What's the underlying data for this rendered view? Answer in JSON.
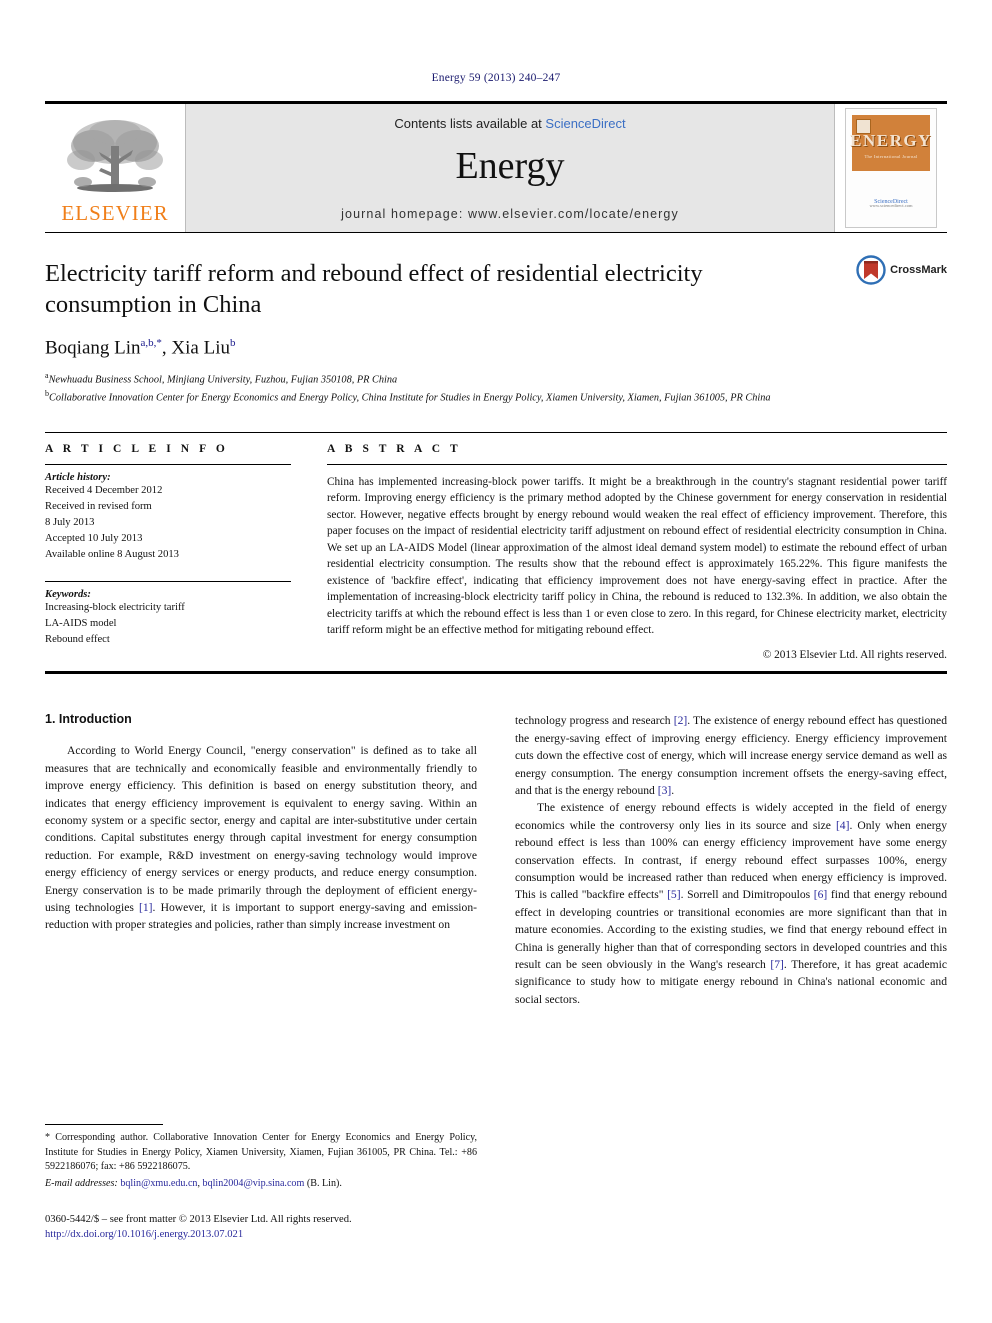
{
  "running_head": "Energy 59 (2013) 240–247",
  "masthead": {
    "publisher_name": "ELSEVIER",
    "contents_prefix": "Contents lists available at ",
    "sciencedirect": "ScienceDirect",
    "journal_name": "Energy",
    "homepage": "journal homepage: www.elsevier.com/locate/energy",
    "cover": {
      "title": "ENERGY",
      "subtitle": "The International Journal",
      "footer": "Available online at",
      "footer_link": "ScienceDirect",
      "footer_note": "www.sciencedirect.com"
    }
  },
  "article": {
    "title": "Electricity tariff reform and rebound effect of residential electricity consumption in China",
    "crossmark_label": "CrossMark",
    "authors": "Boqiang Lin",
    "authors_sup1": "a,b,*",
    "authors_sep": ", Xia Liu",
    "authors_sup2": "b",
    "affiliation_a_sup": "a",
    "affiliation_a": "Newhuadu Business School, Minjiang University, Fuzhou, Fujian 350108, PR China",
    "affiliation_b_sup": "b",
    "affiliation_b": "Collaborative Innovation Center for Energy Economics and Energy Policy, China Institute for Studies in Energy Policy, Xiamen University, Xiamen, Fujian 361005, PR China"
  },
  "info": {
    "heading": "A R T I C L E   I N F O",
    "history_label": "Article history:",
    "history": [
      "Received 4 December 2012",
      "Received in revised form",
      "8 July 2013",
      "Accepted 10 July 2013",
      "Available online 8 August 2013"
    ],
    "keywords_label": "Keywords:",
    "keywords": [
      "Increasing-block electricity tariff",
      "LA-AIDS model",
      "Rebound effect"
    ]
  },
  "abstract": {
    "heading": "A B S T R A C T",
    "text": "China has implemented increasing-block power tariffs. It might be a breakthrough in the country's stagnant residential power tariff reform. Improving energy efficiency is the primary method adopted by the Chinese government for energy conservation in residential sector. However, negative effects brought by energy rebound would weaken the real effect of efficiency improvement. Therefore, this paper focuses on the impact of residential electricity tariff adjustment on rebound effect of residential electricity consumption in China. We set up an LA-AIDS Model (linear approximation of the almost ideal demand system model) to estimate the rebound effect of urban residential electricity consumption. The results show that the rebound effect is approximately 165.22%. This figure manifests the existence of 'backfire effect', indicating that efficiency improvement does not have energy-saving effect in practice. After the implementation of increasing-block electricity tariff policy in China, the rebound is reduced to 132.3%. In addition, we also obtain the electricity tariffs at which the rebound effect is less than 1 or even close to zero. In this regard, for Chinese electricity market, electricity tariff reform might be an effective method for mitigating rebound effect.",
    "copyright": "© 2013 Elsevier Ltd. All rights reserved."
  },
  "body": {
    "section_title": "1. Introduction",
    "left_paragraph_1_a": "According to World Energy Council, \"energy conservation\" is defined as to take all measures that are technically and economically feasible and environmentally friendly to improve energy efficiency. This definition is based on energy substitution theory, and indicates that energy efficiency improvement is equivalent to energy saving. Within an economy system or a specific sector, energy and capital are inter-substitutive under certain conditions. Capital substitutes energy through capital investment for energy consumption reduction. For example, R&D investment on energy-saving technology would improve energy efficiency of energy services or energy products, and reduce energy consumption. Energy conservation is to be made primarily through the deployment of efficient energy-using technologies ",
    "left_ref_1": "[1]",
    "left_paragraph_1_b": ". However, it is important to support energy-saving and emission-reduction with proper strategies and policies, rather than simply increase investment on",
    "right_paragraph_1_a": "technology progress and research ",
    "right_ref_2": "[2]",
    "right_paragraph_1_b": ". The existence of energy rebound effect has questioned the energy-saving effect of improving energy efficiency. Energy efficiency improvement cuts down the effective cost of energy, which will increase energy service demand as well as energy consumption. The energy consumption increment offsets the energy-saving effect, and that is the energy rebound ",
    "right_ref_3": "[3]",
    "right_paragraph_1_c": ".",
    "right_paragraph_2_a": "The existence of energy rebound effects is widely accepted in the field of energy economics while the controversy only lies in its source and size ",
    "right_ref_4": "[4]",
    "right_paragraph_2_b": ". Only when energy rebound effect is less than 100% can energy efficiency improvement have some energy conservation effects. In contrast, if energy rebound effect surpasses 100%, energy consumption would be increased rather than reduced when energy efficiency is improved. This is called \"backfire effects\" ",
    "right_ref_5": "[5]",
    "right_paragraph_2_c": ". Sorrell and Dimitropoulos ",
    "right_ref_6": "[6]",
    "right_paragraph_2_d": " find that energy rebound effect in developing countries or transitional economies are more significant than that in mature economies. According to the existing studies, we find that energy rebound effect in China is generally higher than that of corresponding sectors in developed countries and this result can be seen obviously in the Wang's research ",
    "right_ref_7": "[7]",
    "right_paragraph_2_e": ". Therefore, it has great academic significance to study how to mitigate energy rebound in China's national economic and social sectors."
  },
  "footnotes": {
    "corresponding": "* Corresponding author. Collaborative Innovation Center for Energy Economics and Energy Policy, Institute for Studies in Energy Policy, Xiamen University, Xiamen, Fujian 361005, PR China. Tel.: +86 5922186076; fax: +86 5922186075.",
    "email_label": "E-mail addresses:",
    "email_1": "bqlin@xmu.edu.cn",
    "email_sep": ", ",
    "email_2": "bqlin2004@vip.sina.com",
    "email_attrib": " (B. Lin).",
    "issn_line": "0360-5442/$ – see front matter © 2013 Elsevier Ltd. All rights reserved.",
    "doi": "http://dx.doi.org/10.1016/j.energy.2013.07.021"
  }
}
